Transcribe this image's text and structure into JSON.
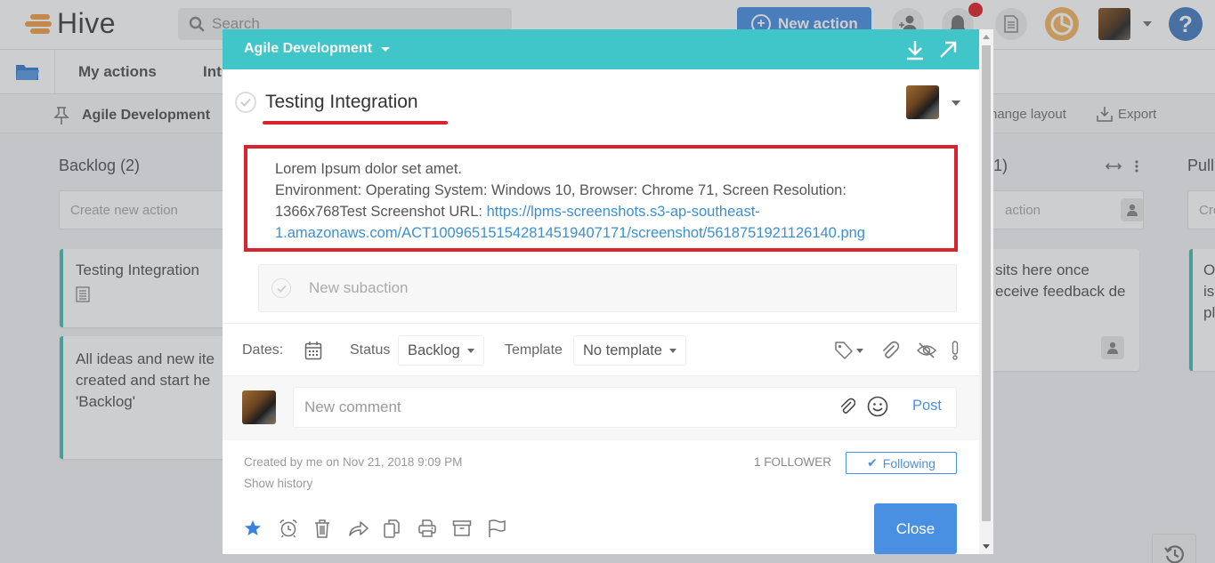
{
  "app": {
    "logo_text": "Hive",
    "search_placeholder": "Search",
    "new_action_label": "New action",
    "brand_color": "#4a90e2",
    "accent_teal": "#40c5c8",
    "highlight_red": "#d9232e"
  },
  "nav": {
    "items": [
      {
        "label": "My actions"
      },
      {
        "label": "Int"
      }
    ]
  },
  "subbar": {
    "project": "Agile Development",
    "change_layout": "hange layout",
    "export": "Export"
  },
  "board": {
    "columns": [
      {
        "title": "Backlog (2)",
        "create_placeholder": "Create new action",
        "cards": [
          {
            "text": "Testing Integration"
          },
          {
            "text": "All ideas and new ite created and start he 'Backlog'"
          }
        ]
      },
      {
        "title": "1)",
        "create_placeholder": "action",
        "cards": [
          {
            "text": "sits here once eceive feedback de"
          }
        ]
      },
      {
        "title": "Pull",
        "create_placeholder": "Cre",
        "cards": [
          {
            "text": "O is pl"
          }
        ]
      }
    ]
  },
  "modal": {
    "project_name": "Agile Development",
    "title": "Testing Integration",
    "description": {
      "line1": "Lorem Ipsum dolor set amet.",
      "line2": "Environment: Operating System: Windows 10, Browser: Chrome 71, Screen Resolution:",
      "line3_prefix": "1366x768Test Screenshot URL: ",
      "link_part1": "https://lpms-screenshots.s3-ap-southeast-",
      "link_part2": "1.amazonaws.com/ACT100965151542814519407171/screenshot/5618751921126140.png"
    },
    "subaction_placeholder": "New subaction",
    "props": {
      "dates_label": "Dates:",
      "status_label": "Status",
      "status_value": "Backlog",
      "template_label": "Template",
      "template_value": "No template"
    },
    "comment": {
      "placeholder": "New comment",
      "post_label": "Post"
    },
    "meta": {
      "created": "Created by me on Nov 21, 2018 9:09 PM",
      "show_history": "Show history",
      "follower_count": "1 FOLLOWER",
      "following_label": "Following"
    },
    "close_label": "Close"
  }
}
